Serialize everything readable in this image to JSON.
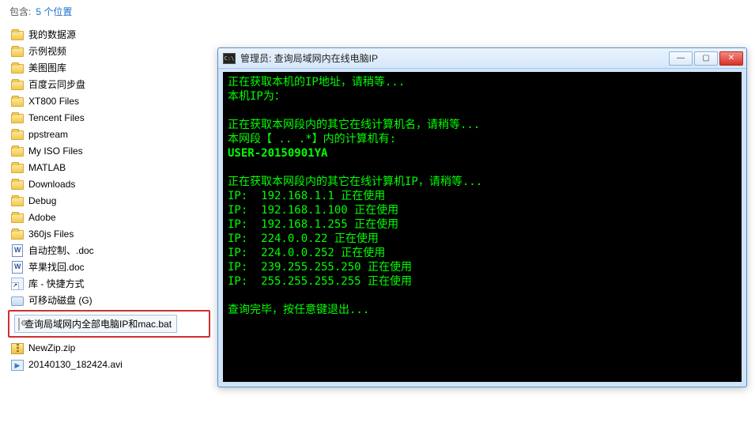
{
  "explorer": {
    "summary_label": "包含:",
    "summary_count": "5 个位置",
    "items": [
      {
        "name": "我的数据源",
        "icon": "folder"
      },
      {
        "name": "示例视频",
        "icon": "folder"
      },
      {
        "name": "美图图库",
        "icon": "folder"
      },
      {
        "name": "百度云同步盘",
        "icon": "folder"
      },
      {
        "name": "XT800 Files",
        "icon": "folder"
      },
      {
        "name": "Tencent Files",
        "icon": "folder"
      },
      {
        "name": "ppstream",
        "icon": "folder"
      },
      {
        "name": "My ISO Files",
        "icon": "folder"
      },
      {
        "name": "MATLAB",
        "icon": "folder"
      },
      {
        "name": "Downloads",
        "icon": "folder"
      },
      {
        "name": "Debug",
        "icon": "folder"
      },
      {
        "name": "Adobe",
        "icon": "folder"
      },
      {
        "name": "360js Files",
        "icon": "folder"
      },
      {
        "name": "自动控制、.doc",
        "icon": "doc"
      },
      {
        "name": "苹果找回.doc",
        "icon": "doc"
      },
      {
        "name": "库 - 快捷方式",
        "icon": "shortcut"
      },
      {
        "name": "可移动磁盘 (G)",
        "icon": "drive"
      }
    ],
    "highlighted": {
      "name": "查询局域网内全部电脑IP和mac.bat",
      "icon": "bat"
    },
    "tail": [
      {
        "name": "NewZip.zip",
        "icon": "zip"
      },
      {
        "name": "20140130_182424.avi",
        "icon": "video"
      }
    ]
  },
  "console": {
    "title": "管理员:  查询局域网内在线电脑IP",
    "app_icon_label": "C:\\",
    "lines": [
      "正在获取本机的IP地址，请稍等...",
      "本机IP为：",
      "",
      "正在获取本网段内的其它在线计算机名，请稍等...",
      "本网段【 .. .*】内的计算机有:",
      "USER-20150901YA",
      "",
      "正在获取本网段内的其它在线计算机IP，请稍等...",
      "IP:  192.168.1.1 正在使用",
      "IP:  192.168.1.100 正在使用",
      "IP:  192.168.1.255 正在使用",
      "IP:  224.0.0.22 正在使用",
      "IP:  224.0.0.252 正在使用",
      "IP:  239.255.255.250 正在使用",
      "IP:  255.255.255.255 正在使用",
      "",
      "查询完毕，按任意键退出..."
    ],
    "bold_line_indices": [
      5
    ],
    "buttons": {
      "minimize": "—",
      "maximize": "▢",
      "close": "✕"
    }
  }
}
